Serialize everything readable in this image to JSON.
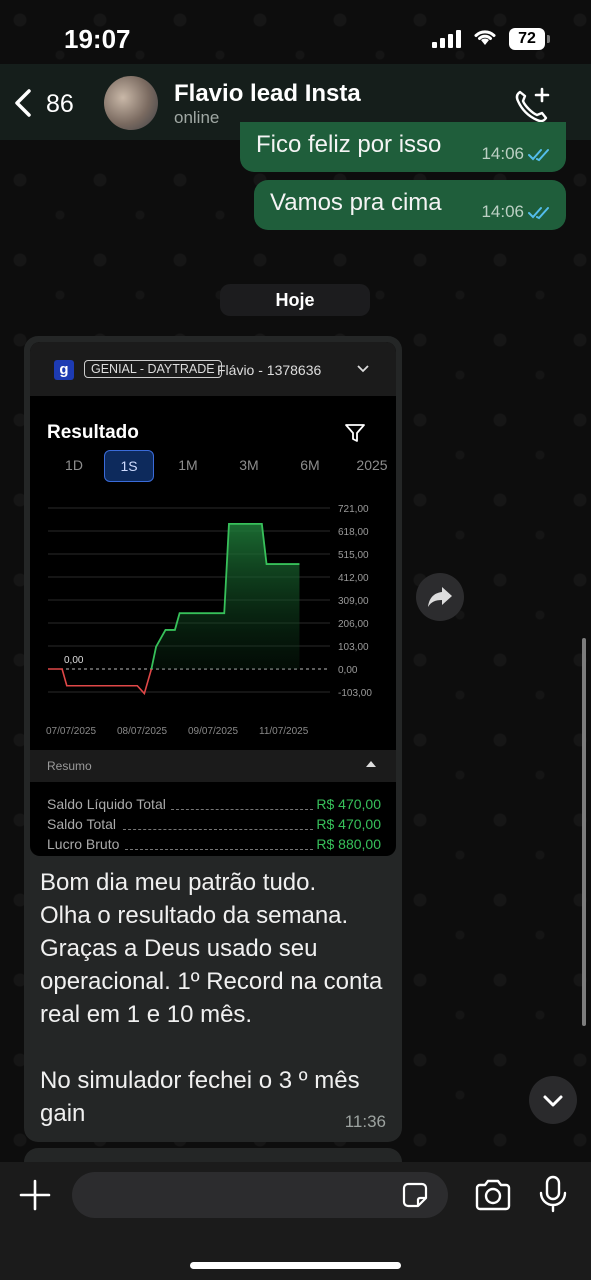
{
  "status_bar": {
    "time": "19:07",
    "battery": "72"
  },
  "header": {
    "back_count": "86",
    "contact_name": "Flavio lead Insta",
    "status": "online",
    "icons": [
      "chevron-left-icon",
      "avatar",
      "add-call-icon"
    ]
  },
  "messages": [
    {
      "text": "Fico feliz por isso",
      "time": "14:06",
      "read": true
    },
    {
      "text": "Vamos pra cima",
      "time": "14:06",
      "read": true
    }
  ],
  "day_separator": "Hoje",
  "incoming": {
    "time": "11:36",
    "caption": "Bom dia meu patrão tudo.\nOlha o resultado da semana.\nGraças a Deus usado seu operacional. 1º Record na conta real em 1 e 10  mês.\n\nNo simulador fechei o 3 º mês gain",
    "screenshot": {
      "logo_letter": "g",
      "platform_tag": "GENIAL - DAYTRADE",
      "account": "Flávio - 1378636",
      "title": "Resultado",
      "tabs": [
        "1D",
        "1S",
        "1M",
        "3M",
        "6M",
        "2025"
      ],
      "active_tab": "1S",
      "summary_label": "Resumo",
      "summary_rows": [
        {
          "label": "Saldo Líquido Total",
          "value": "R$ 470,00"
        },
        {
          "label": "Saldo Total",
          "value": "R$ 470,00"
        },
        {
          "label": "Lucro Bruto",
          "value": "R$ 880,00"
        }
      ]
    }
  },
  "chart_data": {
    "type": "line",
    "y_ticks": [
      "721,00",
      "618,00",
      "515,00",
      "412,00",
      "309,00",
      "206,00",
      "103,00",
      "0,00",
      "-103,00"
    ],
    "x_ticks": [
      "07/07/2025",
      "08/07/2025",
      "09/07/2025",
      "11/07/2025"
    ],
    "zero_label": "0,00",
    "ylim": [
      -103,
      721
    ],
    "points": [
      [
        0,
        0
      ],
      [
        0.3,
        0
      ],
      [
        0.4,
        -75
      ],
      [
        1.9,
        -75
      ],
      [
        2.05,
        -110
      ],
      [
        2.2,
        0
      ],
      [
        2.3,
        100
      ],
      [
        2.5,
        175
      ],
      [
        2.7,
        175
      ],
      [
        2.8,
        250
      ],
      [
        3.0,
        250
      ],
      [
        3.4,
        250
      ],
      [
        3.75,
        250
      ],
      [
        3.85,
        650
      ],
      [
        4.55,
        650
      ],
      [
        4.65,
        470
      ],
      [
        5.35,
        470
      ]
    ],
    "series": [
      {
        "name": "",
        "color_positive": "#37c05a",
        "color_negative": "#e04848"
      }
    ],
    "grid": true
  },
  "composer": {
    "placeholder": ""
  },
  "colors": {
    "outgoing_bubble": "#1f5e3b",
    "incoming_bubble": "#242626",
    "tick_blue": "#53bdeb"
  }
}
